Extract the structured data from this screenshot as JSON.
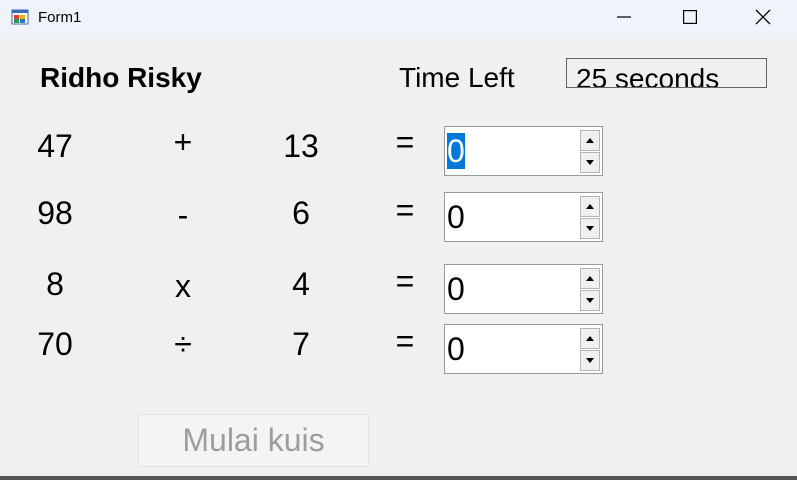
{
  "window": {
    "title": "Form1",
    "app_icon": "winforms-app-icon",
    "controls": [
      "minimize-icon",
      "maximize-icon",
      "close-icon"
    ]
  },
  "quiz": {
    "player_name": "Ridho Risky",
    "time_label": "Time Left",
    "time_value": "25 seconds",
    "problems": [
      {
        "left": "47",
        "operator": "+",
        "right": "13",
        "equals": "=",
        "answer": "0"
      },
      {
        "left": "98",
        "operator": "-",
        "right": "6",
        "equals": "=",
        "answer": "0"
      },
      {
        "left": "8",
        "operator": "x",
        "right": "4",
        "equals": "=",
        "answer": "0"
      },
      {
        "left": "70",
        "operator": "÷",
        "right": "7",
        "equals": "=",
        "answer": "0"
      }
    ],
    "start_button": "Mulai kuis"
  },
  "colors": {
    "selection": "#0078d7",
    "disabled_text": "#9d9d9d",
    "background": "#f0f0f0"
  }
}
